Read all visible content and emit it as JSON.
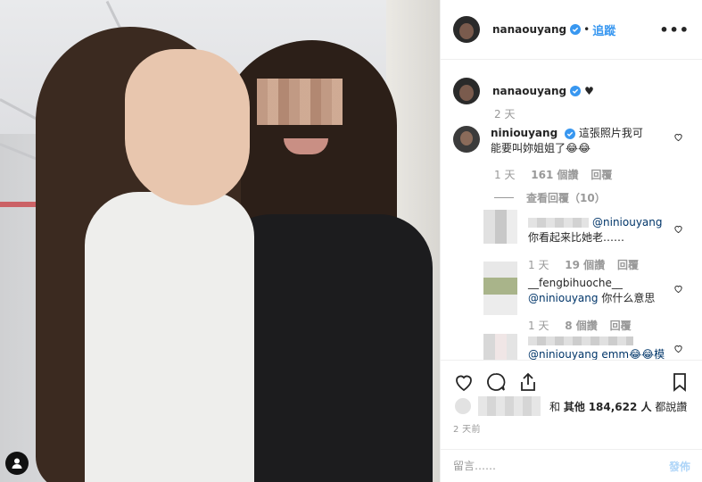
{
  "post": {
    "author": "nanaouyang",
    "follow_label": "追蹤",
    "more_label": "•••",
    "caption": {
      "username": "nanaouyang",
      "text": "♥",
      "age": "2 天"
    },
    "comment": {
      "username": "niniouyang",
      "text": "這張照片我可能要叫妳姐姐了😂😂",
      "age": "1 天",
      "likes": "161 個讚",
      "reply_label": "回覆",
      "view_replies": "查看回覆（10）"
    },
    "replies": [
      {
        "mention": "@niniouyang",
        "text": "你看起来比她老……",
        "age": "1 天",
        "likes": "19 個讚",
        "reply_label": "回覆"
      },
      {
        "username": "__fengbihuoche__",
        "mention": "@niniouyang",
        "text": "你什么意思",
        "age": "1 天",
        "likes": "8 個讚",
        "reply_label": "回覆"
      },
      {
        "partial_text": "@niniouyang emm😂😂模"
      }
    ],
    "likes_line": {
      "and_other": "和",
      "others": "其他",
      "count": "184,622 人",
      "suffix": "都說讚"
    },
    "time_ago": "2 天前",
    "comment_placeholder": "留言……",
    "post_label": "發佈"
  },
  "colors": {
    "accent": "#3897f0",
    "muted": "#999999",
    "text": "#262626",
    "border": "#efefef"
  },
  "icons": [
    "verified-badge-icon",
    "heart-icon",
    "comment-icon",
    "share-icon",
    "bookmark-icon",
    "user-tag-icon"
  ]
}
